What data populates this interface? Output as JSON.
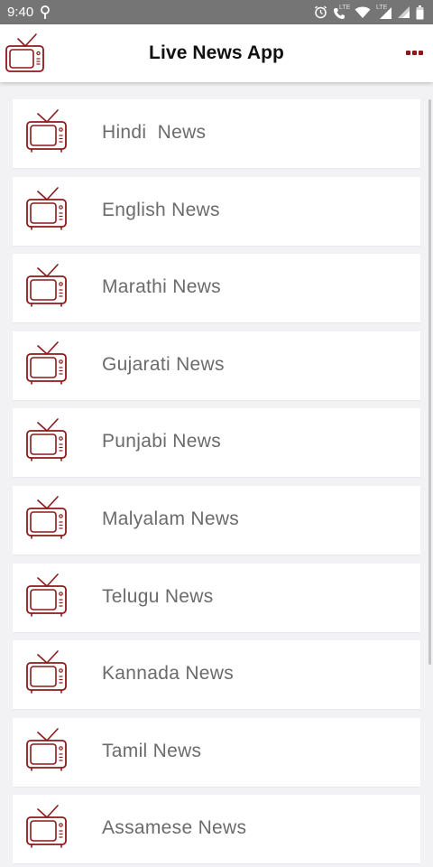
{
  "status_bar": {
    "time": "9:40",
    "lte_label_1": "LTE",
    "lte_label_2": "LTE",
    "icons": [
      "location-pin-icon",
      "alarm-icon",
      "phone-lte-icon",
      "wifi-icon",
      "signal-icon",
      "signal-icon",
      "battery-icon"
    ]
  },
  "app_bar": {
    "title": "Live News App",
    "logo_icon": "tv-icon",
    "menu_icon": "more-options-icon"
  },
  "colors": {
    "accent": "#8b1a1a",
    "status_bar": "#757575",
    "background": "#f2f2f4",
    "card": "#ffffff",
    "label": "#6b6b6b"
  },
  "news_list": [
    {
      "label": "Hindi  News",
      "icon": "tv-icon"
    },
    {
      "label": "English News",
      "icon": "tv-icon"
    },
    {
      "label": "Marathi News",
      "icon": "tv-icon"
    },
    {
      "label": "Gujarati News",
      "icon": "tv-icon"
    },
    {
      "label": "Punjabi News",
      "icon": "tv-icon"
    },
    {
      "label": "Malyalam News",
      "icon": "tv-icon"
    },
    {
      "label": "Telugu News",
      "icon": "tv-icon"
    },
    {
      "label": "Kannada News",
      "icon": "tv-icon"
    },
    {
      "label": "Tamil News",
      "icon": "tv-icon"
    },
    {
      "label": "Assamese News",
      "icon": "tv-icon"
    }
  ]
}
